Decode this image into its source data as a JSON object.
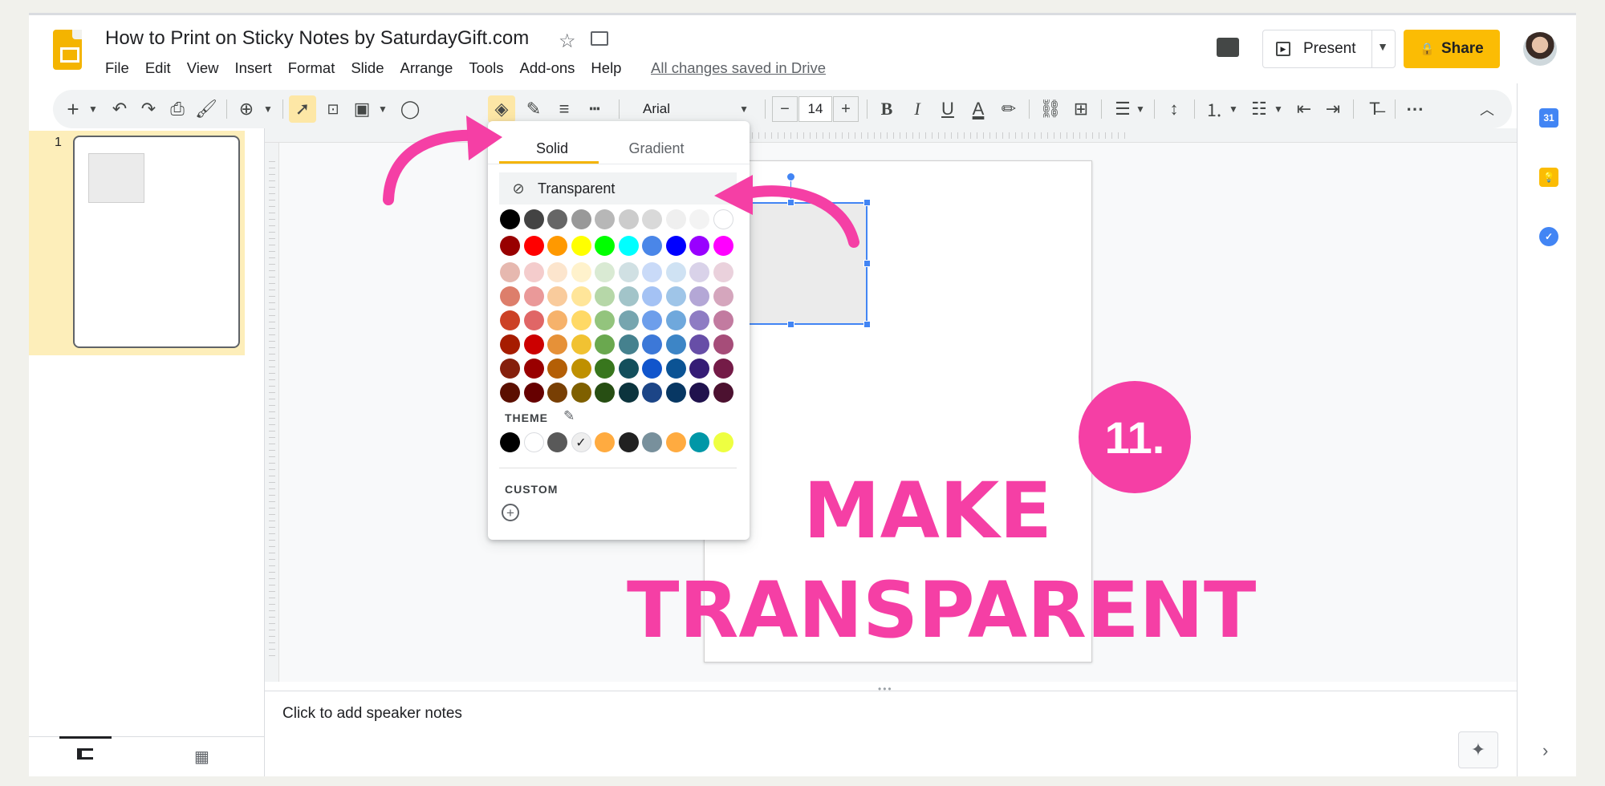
{
  "window": {
    "title": "How to Print on Sticky Notes by SaturdayGift.com",
    "menu": [
      "File",
      "Edit",
      "View",
      "Insert",
      "Format",
      "Slide",
      "Arrange",
      "Tools",
      "Add-ons",
      "Help"
    ],
    "save_status": "All changes saved in Drive",
    "present_label": "Present",
    "share_label": "Share"
  },
  "toolbar": {
    "font": "Arial",
    "font_size": "14",
    "minus": "−",
    "plus": "+"
  },
  "filmstrip": {
    "slide_number": "1"
  },
  "notes": {
    "placeholder": "Click to add speaker notes"
  },
  "fill_menu": {
    "tabs": [
      "Solid",
      "Gradient"
    ],
    "transparent_label": "Transparent",
    "theme_label": "THEME",
    "custom_label": "CUSTOM",
    "grid_colors": [
      [
        "#000000",
        "#434343",
        "#666666",
        "#999999",
        "#b7b7b7",
        "#cccccc",
        "#d9d9d9",
        "#efefef",
        "#f3f3f3",
        "#ffffff"
      ],
      [
        "#980000",
        "#ff0000",
        "#ff9900",
        "#ffff00",
        "#00ff00",
        "#00ffff",
        "#4a86e8",
        "#0000ff",
        "#9900ff",
        "#ff00ff"
      ],
      [
        "#e6b8af",
        "#f4cccc",
        "#fce5cd",
        "#fff2cc",
        "#d9ead3",
        "#d0e0e3",
        "#c9daf8",
        "#cfe2f3",
        "#d9d2e9",
        "#ead1dc"
      ],
      [
        "#dd7e6b",
        "#ea9999",
        "#f9cb9c",
        "#ffe599",
        "#b6d7a8",
        "#a2c4c9",
        "#a4c2f4",
        "#9fc5e8",
        "#b4a7d6",
        "#d5a6bd"
      ],
      [
        "#cc4125",
        "#e06666",
        "#f6b26b",
        "#ffd966",
        "#93c47d",
        "#76a5af",
        "#6d9eeb",
        "#6fa8dc",
        "#8e7cc3",
        "#c27ba0"
      ],
      [
        "#a61c00",
        "#cc0000",
        "#e69138",
        "#f1c232",
        "#6aa84f",
        "#45818e",
        "#3c78d8",
        "#3d85c6",
        "#674ea7",
        "#a64d79"
      ],
      [
        "#85200c",
        "#990000",
        "#b45f06",
        "#bf9000",
        "#38761d",
        "#134f5c",
        "#1155cc",
        "#0b5394",
        "#351c75",
        "#741b47"
      ],
      [
        "#5b0f00",
        "#660000",
        "#783f04",
        "#7f6000",
        "#274e13",
        "#0c343d",
        "#1c4587",
        "#073763",
        "#20124d",
        "#4c1130"
      ]
    ],
    "theme_colors": [
      "#000000",
      "#ffffff",
      "#595959",
      "#eeeeee",
      "#ffab40",
      "#212121",
      "#78909c",
      "#ffab40",
      "#0097a7",
      "#eeff41"
    ],
    "selected_theme_index": 3
  },
  "overlay": {
    "step": "11.",
    "line1": "MAKE",
    "line2": "TRANSPARENT",
    "accent": "#f53fa5"
  },
  "colors": {
    "slides_yellow": "#f4b400",
    "share_yellow": "#fbbc04",
    "selection_blue": "#4285f4"
  }
}
